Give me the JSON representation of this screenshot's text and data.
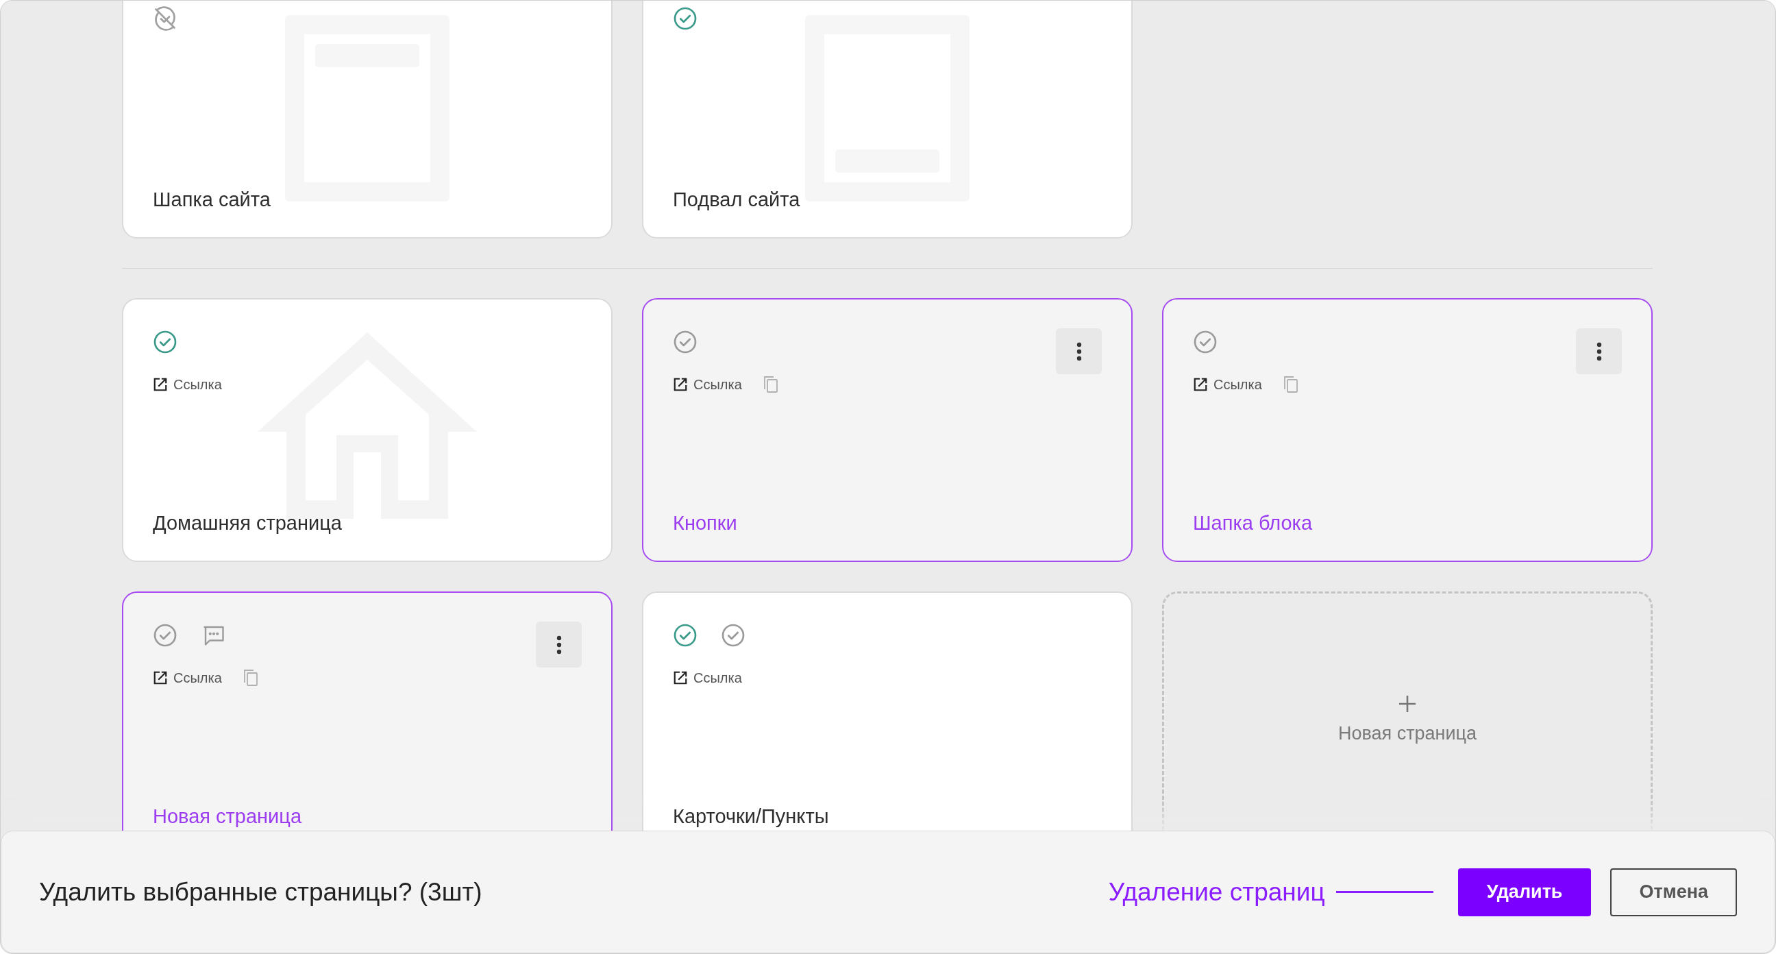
{
  "sections": [
    {
      "cards": [
        {
          "title": "Шапка сайта",
          "selected": false,
          "kind": "header",
          "statuses": [
            {
              "kind": "hidden"
            }
          ],
          "menu": false
        },
        {
          "title": "Подвал сайта",
          "selected": false,
          "kind": "footer",
          "statuses": [
            {
              "kind": "published"
            }
          ],
          "menu": false
        }
      ]
    },
    {
      "cards": [
        {
          "title": "Домашняя страница",
          "selected": false,
          "kind": "home",
          "statuses": [
            {
              "kind": "published"
            }
          ],
          "link": "Ссылка",
          "copy": false,
          "menu": false
        },
        {
          "title": "Кнопки",
          "selected": true,
          "kind": "blank",
          "statuses": [
            {
              "kind": "unpublished"
            }
          ],
          "link": "Ссылка",
          "copy": true,
          "menu": true
        },
        {
          "title": "Шапка блока",
          "selected": true,
          "kind": "blank",
          "statuses": [
            {
              "kind": "unpublished"
            }
          ],
          "link": "Ссылка",
          "copy": true,
          "menu": true
        },
        {
          "title": "Новая страница",
          "selected": true,
          "kind": "blank",
          "statuses": [
            {
              "kind": "unpublished"
            },
            {
              "kind": "comment"
            }
          ],
          "link": "Ссылка",
          "copy": true,
          "menu": true
        },
        {
          "title": "Карточки/Пункты",
          "selected": false,
          "kind": "blank",
          "statuses": [
            {
              "kind": "published"
            },
            {
              "kind": "unpublished"
            }
          ],
          "link": "Ссылка",
          "copy": false,
          "menu": false
        }
      ],
      "new_page": {
        "label": "Новая страница"
      }
    }
  ],
  "confirm_bar": {
    "message": "Удалить выбранные страницы? (3шт)",
    "annotation": "Удаление страниц",
    "buttons": [
      {
        "label": "Удалить",
        "kind": "primary"
      },
      {
        "label": "Отмена",
        "kind": "secondary"
      }
    ]
  }
}
